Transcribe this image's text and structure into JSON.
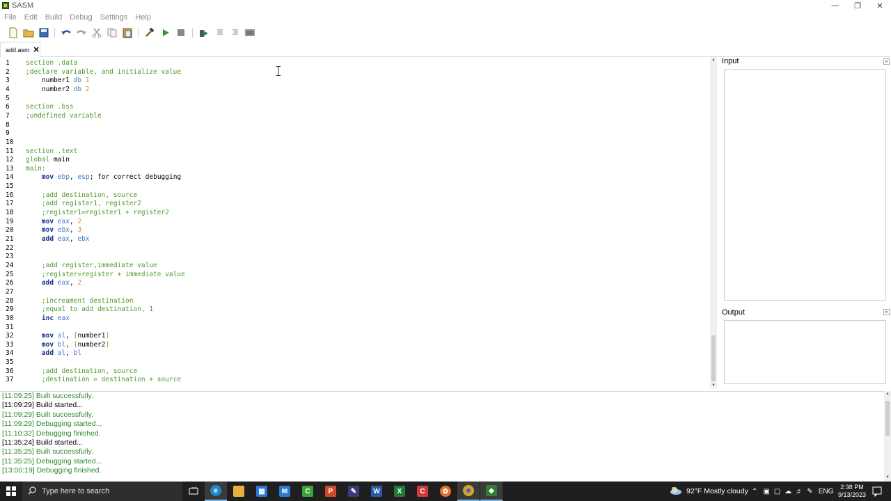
{
  "window": {
    "title": "SASM"
  },
  "menu": [
    "File",
    "Edit",
    "Build",
    "Debug",
    "Settings",
    "Help"
  ],
  "tab": {
    "label": "add.asm"
  },
  "editor": {
    "lines": [
      {
        "n": "1",
        "tokens": [
          [
            "dir",
            "section .data"
          ]
        ]
      },
      {
        "n": "2",
        "tokens": [
          [
            "com",
            ";declare variable, and initialize value"
          ]
        ]
      },
      {
        "n": "3",
        "tokens": [
          [
            "plain",
            "    number1 "
          ],
          [
            "reg",
            "db"
          ],
          [
            "plain",
            " "
          ],
          [
            "num",
            "1"
          ]
        ]
      },
      {
        "n": "4",
        "tokens": [
          [
            "plain",
            "    number2 "
          ],
          [
            "reg",
            "db"
          ],
          [
            "plain",
            " "
          ],
          [
            "num",
            "2"
          ]
        ]
      },
      {
        "n": "5",
        "tokens": []
      },
      {
        "n": "6",
        "tokens": [
          [
            "dir",
            "section .bss"
          ]
        ]
      },
      {
        "n": "7",
        "tokens": [
          [
            "com",
            ";undefined variable"
          ]
        ]
      },
      {
        "n": "8",
        "tokens": []
      },
      {
        "n": "9",
        "tokens": []
      },
      {
        "n": "10",
        "tokens": []
      },
      {
        "n": "11",
        "tokens": [
          [
            "dir",
            "section .text"
          ]
        ]
      },
      {
        "n": "12",
        "tokens": [
          [
            "dir",
            "global"
          ],
          [
            "plain",
            " main"
          ]
        ]
      },
      {
        "n": "13",
        "tokens": [
          [
            "dir",
            "main:"
          ]
        ]
      },
      {
        "n": "14",
        "tokens": [
          [
            "plain",
            "    "
          ],
          [
            "kw",
            "mov"
          ],
          [
            "plain",
            " "
          ],
          [
            "reg",
            "ebp"
          ],
          [
            "plain",
            ", "
          ],
          [
            "reg",
            "esp"
          ],
          [
            "plain",
            "; for correct debugging"
          ]
        ]
      },
      {
        "n": "15",
        "tokens": []
      },
      {
        "n": "16",
        "tokens": [
          [
            "plain",
            "    "
          ],
          [
            "com",
            ";add destination, source"
          ]
        ]
      },
      {
        "n": "17",
        "tokens": [
          [
            "plain",
            "    "
          ],
          [
            "com",
            ";add register1, register2"
          ]
        ]
      },
      {
        "n": "18",
        "tokens": [
          [
            "plain",
            "    "
          ],
          [
            "com",
            ";register1=register1 + register2"
          ]
        ]
      },
      {
        "n": "19",
        "tokens": [
          [
            "plain",
            "    "
          ],
          [
            "kw",
            "mov"
          ],
          [
            "plain",
            " "
          ],
          [
            "reg",
            "eax"
          ],
          [
            "plain",
            ", "
          ],
          [
            "num",
            "2"
          ]
        ]
      },
      {
        "n": "20",
        "tokens": [
          [
            "plain",
            "    "
          ],
          [
            "kw",
            "mov"
          ],
          [
            "plain",
            " "
          ],
          [
            "reg",
            "ebx"
          ],
          [
            "plain",
            ", "
          ],
          [
            "num",
            "3"
          ]
        ]
      },
      {
        "n": "21",
        "tokens": [
          [
            "plain",
            "    "
          ],
          [
            "kw",
            "add"
          ],
          [
            "plain",
            " "
          ],
          [
            "reg",
            "eax"
          ],
          [
            "plain",
            ", "
          ],
          [
            "reg",
            "ebx"
          ]
        ]
      },
      {
        "n": "22",
        "tokens": []
      },
      {
        "n": "23",
        "tokens": []
      },
      {
        "n": "24",
        "tokens": [
          [
            "plain",
            "    "
          ],
          [
            "com",
            ";add register,immediate value"
          ]
        ]
      },
      {
        "n": "25",
        "tokens": [
          [
            "plain",
            "    "
          ],
          [
            "com",
            ";register=register + immediate value"
          ]
        ]
      },
      {
        "n": "26",
        "tokens": [
          [
            "plain",
            "    "
          ],
          [
            "kw",
            "add"
          ],
          [
            "plain",
            " "
          ],
          [
            "reg",
            "eax"
          ],
          [
            "plain",
            ", "
          ],
          [
            "num",
            "2"
          ]
        ]
      },
      {
        "n": "27",
        "tokens": []
      },
      {
        "n": "28",
        "tokens": [
          [
            "plain",
            "    "
          ],
          [
            "com",
            ";increament destination"
          ]
        ]
      },
      {
        "n": "29",
        "tokens": [
          [
            "plain",
            "    "
          ],
          [
            "com",
            ";equal to add destination, 1"
          ]
        ]
      },
      {
        "n": "30",
        "tokens": [
          [
            "plain",
            "    "
          ],
          [
            "kw",
            "inc"
          ],
          [
            "plain",
            " "
          ],
          [
            "reg",
            "eax"
          ]
        ]
      },
      {
        "n": "31",
        "tokens": []
      },
      {
        "n": "32",
        "tokens": [
          [
            "plain",
            "    "
          ],
          [
            "kw",
            "mov"
          ],
          [
            "plain",
            " "
          ],
          [
            "reg",
            "al"
          ],
          [
            "plain",
            ", "
          ],
          [
            "mem",
            "["
          ],
          [
            "plain",
            "number1"
          ],
          [
            "mem",
            "]"
          ]
        ]
      },
      {
        "n": "33",
        "tokens": [
          [
            "plain",
            "    "
          ],
          [
            "kw",
            "mov"
          ],
          [
            "plain",
            " "
          ],
          [
            "reg",
            "bl"
          ],
          [
            "plain",
            ", "
          ],
          [
            "mem",
            "["
          ],
          [
            "plain",
            "number2"
          ],
          [
            "mem",
            "]"
          ]
        ]
      },
      {
        "n": "34",
        "tokens": [
          [
            "plain",
            "    "
          ],
          [
            "kw",
            "add"
          ],
          [
            "plain",
            " "
          ],
          [
            "reg",
            "al"
          ],
          [
            "plain",
            ", "
          ],
          [
            "reg",
            "bl"
          ]
        ]
      },
      {
        "n": "35",
        "tokens": []
      },
      {
        "n": "36",
        "tokens": [
          [
            "plain",
            "    "
          ],
          [
            "com",
            ";add destination, source"
          ]
        ]
      },
      {
        "n": "37",
        "tokens": [
          [
            "plain",
            "    "
          ],
          [
            "com",
            ";destination = destination + source"
          ]
        ]
      }
    ]
  },
  "panels": {
    "input_title": "Input",
    "output_title": "Output"
  },
  "log": [
    {
      "text": "[11:09:25] Built successfully.",
      "color": "green"
    },
    {
      "text": "[11:09:29] Build started...",
      "color": "black"
    },
    {
      "text": "[11:09:29] Built successfully.",
      "color": "green"
    },
    {
      "text": "[11:09:29] Debugging started...",
      "color": "green"
    },
    {
      "text": "[11:10:32] Debugging finished.",
      "color": "green"
    },
    {
      "text": "[11:35:24] Build started...",
      "color": "black"
    },
    {
      "text": "[11:35:25] Built successfully.",
      "color": "green"
    },
    {
      "text": "[11:35:25] Debugging started...",
      "color": "green"
    },
    {
      "text": "[13:00:19] Debugging finished.",
      "color": "green"
    }
  ],
  "taskbar": {
    "search_placeholder": "Type here to search",
    "weather": "92°F  Mostly cloudy",
    "language": "ENG",
    "time": "2:38 PM",
    "date": "9/13/2023"
  }
}
